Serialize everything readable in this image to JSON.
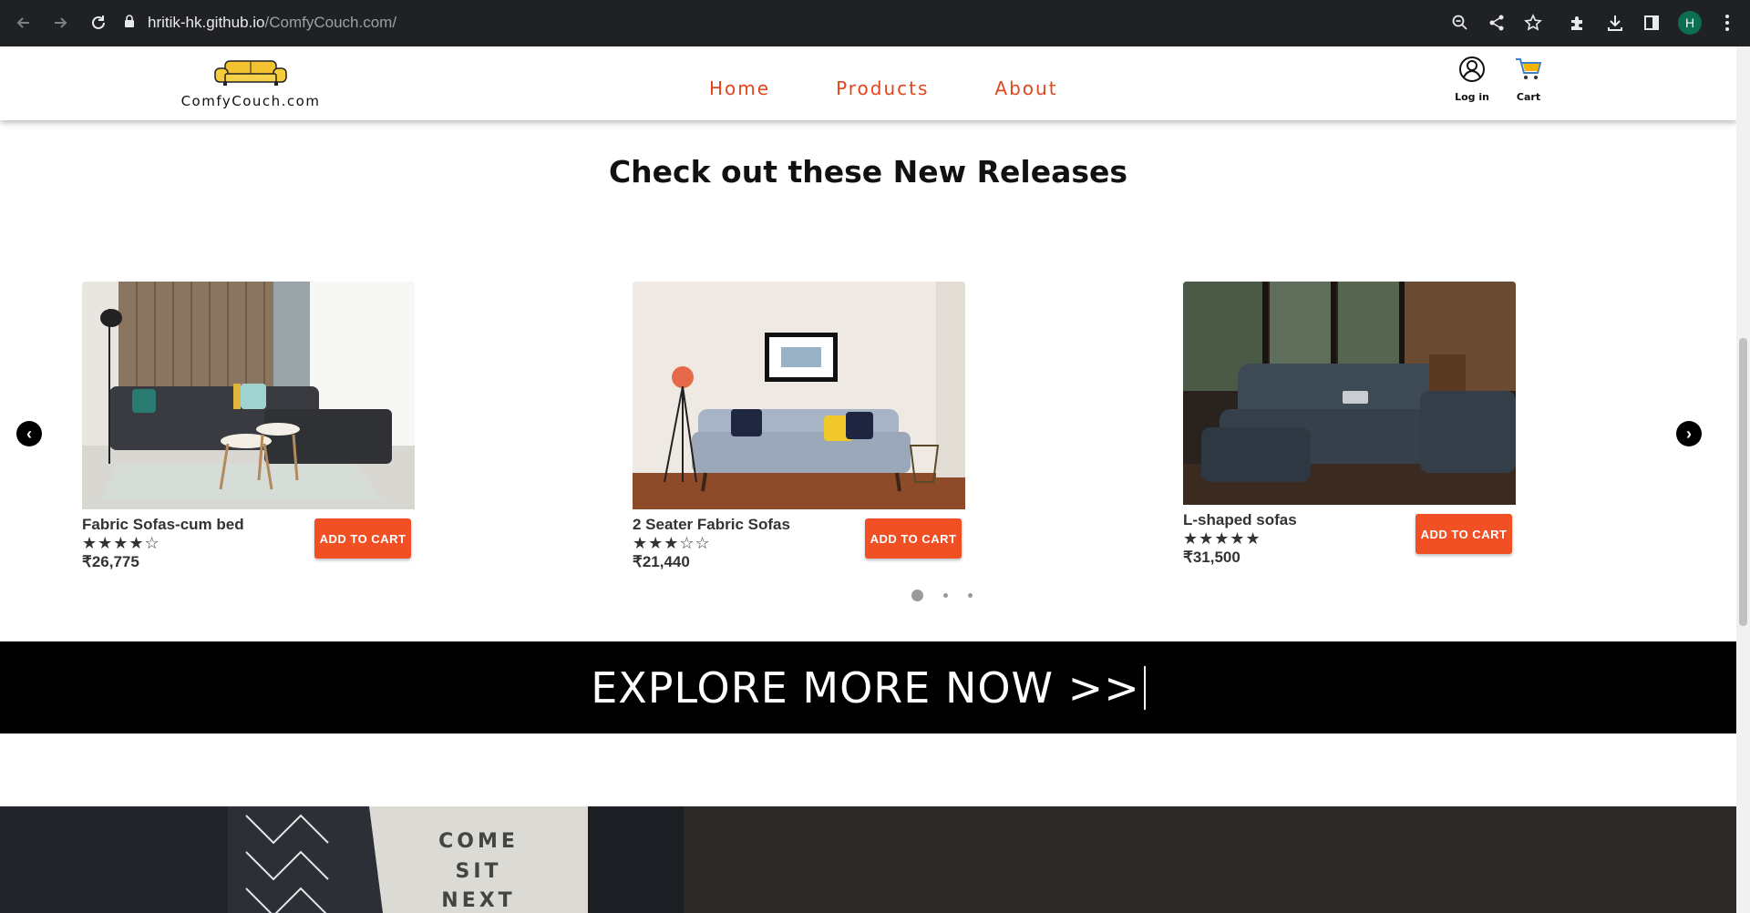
{
  "browser": {
    "url_host": "hritik-hk.github.io",
    "url_path": "/ComfyCouch.com/",
    "profile_initial": "H"
  },
  "site": {
    "logo_text": "ComfyCouch.com",
    "nav": [
      "Home",
      "Products",
      "About"
    ],
    "login_label": "Log in",
    "cart_label": "Cart",
    "accent_color": "#e2451b"
  },
  "section": {
    "title": "Check out these New Releases"
  },
  "products": [
    {
      "name": "Fabric Sofas-cum bed",
      "rating": 4,
      "stars": "★★★★☆",
      "price": "₹26,775",
      "button": "ADD TO CART"
    },
    {
      "name": "2 Seater Fabric Sofas",
      "rating": 3,
      "stars": "★★★☆☆",
      "price": "₹21,440",
      "button": "ADD TO CART"
    },
    {
      "name": "L-shaped sofas",
      "rating": 5,
      "stars": "★★★★★",
      "price": "₹31,500",
      "button": "ADD TO CART"
    }
  ],
  "carousel": {
    "active_index": 0,
    "dot_count": 3
  },
  "explore": {
    "label": "EXPLORE MORE NOW >>"
  },
  "bottom": {
    "pillow_text": "COME SIT NEXT"
  }
}
